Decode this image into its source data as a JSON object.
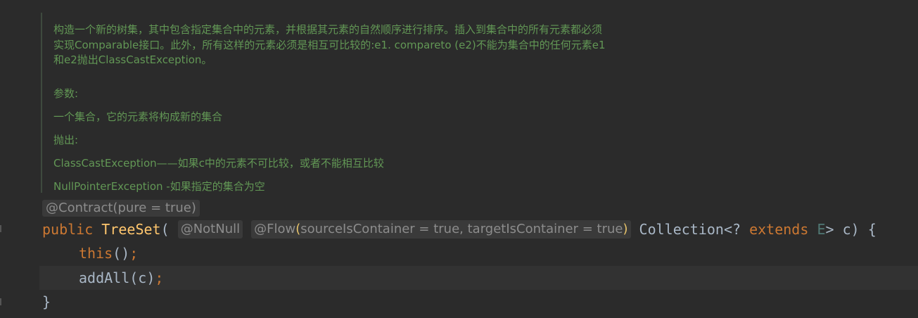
{
  "javadoc": {
    "description": "构造一个新的树集，其中包含指定集合中的元素，并根据其元素的自然顺序进行排序。插入到集合中的所有元素都必须实现Comparable接口。此外，所有这样的元素必须是相互可比较的:e1. compareto (e2)不能为集合中的任何元素e1和e2抛出ClassCastException。",
    "params_label": "参数:",
    "param_desc": "一个集合，它的元素将构成新的集合",
    "throws_label": "抛出:",
    "throws_1": "ClassCastException——如果c中的元素不可比较，或者不能相互比较",
    "throws_2": "NullPointerException -如果指定的集合为空"
  },
  "annotation": "@Contract(pure = true)",
  "code": {
    "public": "public",
    "ctor": "TreeSet",
    "open": "(",
    "notnull": "@NotNull",
    "flow_name": "@Flow",
    "flow_args": "sourceIsContainer = true, targetIsContainer = true",
    "collection": "Collection<? ",
    "extends": "extends",
    "E": "E",
    "rest": "> c) {",
    "this_call": "this",
    "this_rest": "()",
    "semi": ";",
    "addall": "addAll(c)",
    "close": "}"
  }
}
